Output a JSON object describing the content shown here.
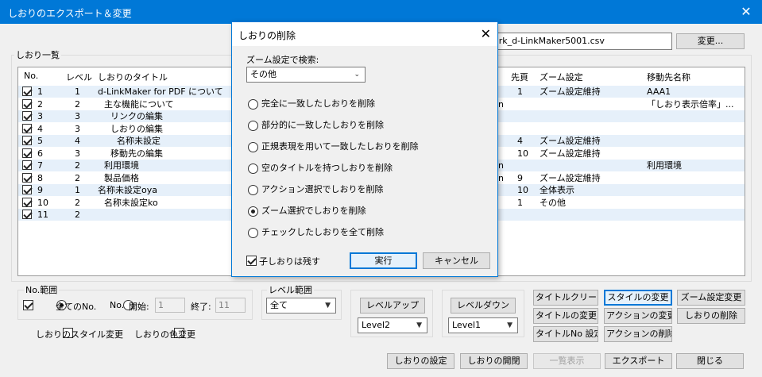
{
  "window": {
    "title": "しおりのエクスポート＆変更",
    "close_glyph": "✕"
  },
  "file": {
    "path_suffix": "ark_d-LinkMaker5001.csv",
    "change_label": "変更..."
  },
  "list": {
    "group_label": "しおり一覧",
    "columns": [
      "No.",
      "レベル",
      "しおりのタイトル",
      "先頁",
      "ズーム設定",
      "移動先名称"
    ],
    "rows": [
      {
        "no": "1",
        "level": "1",
        "title": "d-LinkMaker for PDF について",
        "page": "1",
        "zoom": "ズーム設定維持",
        "dest": "AAA1",
        "mid": ""
      },
      {
        "no": "2",
        "level": "2",
        "title": "主な機能について",
        "page": "",
        "zoom": "",
        "dest": "「しおり表示倍率」...",
        "mid": "n"
      },
      {
        "no": "3",
        "level": "3",
        "title": "リンクの編集",
        "page": "",
        "zoom": "",
        "dest": "",
        "mid": ""
      },
      {
        "no": "4",
        "level": "3",
        "title": "しおりの編集",
        "page": "",
        "zoom": "",
        "dest": "",
        "mid": ""
      },
      {
        "no": "5",
        "level": "4",
        "title": "名称未設定",
        "page": "4",
        "zoom": "ズーム設定維持",
        "dest": "",
        "mid": ""
      },
      {
        "no": "6",
        "level": "3",
        "title": "移動先の編集",
        "page": "10",
        "zoom": "ズーム設定維持",
        "dest": "",
        "mid": ""
      },
      {
        "no": "7",
        "level": "2",
        "title": "利用環境",
        "page": "",
        "zoom": "",
        "dest": "利用環境",
        "mid": "n"
      },
      {
        "no": "8",
        "level": "2",
        "title": "製品価格",
        "page": "9",
        "zoom": "ズーム設定維持",
        "dest": "",
        "mid": "n"
      },
      {
        "no": "9",
        "level": "1",
        "title": "名称未設定oya",
        "page": "10",
        "zoom": "全体表示",
        "dest": "",
        "mid": ""
      },
      {
        "no": "10",
        "level": "2",
        "title": "名称未設定ko",
        "page": "1",
        "zoom": "その他",
        "dest": "",
        "mid": ""
      },
      {
        "no": "11",
        "level": "2",
        "title": "",
        "page": "",
        "zoom": "",
        "dest": "",
        "mid": ""
      }
    ]
  },
  "range": {
    "group_label": "No.範囲",
    "all_label": "全てのNo.",
    "no_label": "No.",
    "start_label": "開始:",
    "start_value": "1",
    "end_label": "終了:",
    "end_value": "11"
  },
  "level_range": {
    "group_label": "レベル範囲",
    "selected": "全て"
  },
  "level_up": {
    "label": "レベルアップ",
    "selected": "Level2"
  },
  "level_down": {
    "label": "レベルダウン",
    "selected": "Level1"
  },
  "checks": {
    "style_change": "しおりのスタイル変更",
    "color_change": "しおりの色変更"
  },
  "right_buttons": {
    "title_clean": "タイトルクリーン",
    "style_change": "スタイルの変更",
    "zoom_change": "ズーム設定変更",
    "title_change": "タイトルの変更",
    "action_change": "アクションの変更",
    "delete": "しおりの削除",
    "title_no": "タイトルNo 設定",
    "action_delete": "アクションの削除"
  },
  "bottom_buttons": {
    "settings": "しおりの設定",
    "expand": "しおりの開閉",
    "list_view": "一覧表示",
    "export": "エクスポート",
    "close": "閉じる"
  },
  "dialog": {
    "title": "しおりの削除",
    "zoom_search_label": "ズーム設定で検索:",
    "zoom_selected": "その他",
    "options": [
      "完全に一致したしおりを削除",
      "部分的に一致したしおりを削除",
      "正規表現を用いて一致したしおりを削除",
      "空のタイトルを持つしおりを削除",
      "アクション選択でしおりを削除",
      "ズーム選択でしおりを削除",
      "チェックしたしおりを全て削除"
    ],
    "selected_option_index": 5,
    "keep_children_label": "子しおりは残す",
    "run_label": "実行",
    "cancel_label": "キャンセル"
  }
}
